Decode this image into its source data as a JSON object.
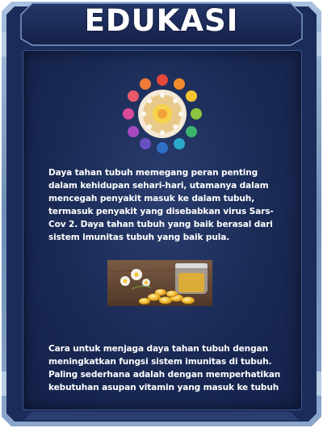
{
  "header": {
    "title": "EDUKASI"
  },
  "content": {
    "paragraph_1": "Daya tahan tubuh memegang peran penting dalam kehidupan sehari-hari, utamanya dalam mencegah penyakit masuk ke dalam tubuh, termasuk penyakit yang disebabkan virus Sars-Cov 2. Daya tahan tubuh yang baik berasal dari sistem imunitas tubuh yang baik pula.",
    "paragraph_2": "Cara untuk menjaga daya tahan tubuh dengan meningkatkan fungsi sistem imunitas di tubuh. Paling sederhana adalah dengan memperhatikan kebutuhan asupan vitamin yang masuk ke tubuh",
    "icon": "vitamin-wheel-icon",
    "image": "vitamin-capsules-photo"
  },
  "colors": {
    "frame": "#5f7ea8",
    "frame_light": "#9fb8d8",
    "title_bar": "#1b2a5a",
    "panel": "#1a2a55",
    "text": "#ffffff"
  }
}
